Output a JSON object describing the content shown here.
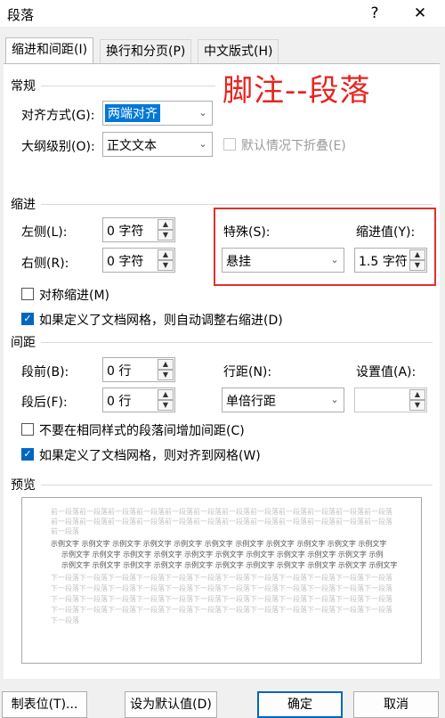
{
  "dialog": {
    "title": "段落",
    "help_label": "?",
    "close_label": "✕"
  },
  "tabs": [
    {
      "label": "缩进和间距(I)",
      "active": true
    },
    {
      "label": "换行和分页(P)",
      "active": false
    },
    {
      "label": "中文版式(H)",
      "active": false
    }
  ],
  "annotation": "脚注--段落",
  "general": {
    "section_label": "常规",
    "alignment_label": "对齐方式(G):",
    "alignment_value": "两端对齐",
    "outline_label": "大纲级别(O):",
    "outline_value": "正文文本",
    "collapse_label": "默认情况下折叠(E)"
  },
  "indent": {
    "section_label": "缩进",
    "left_label": "左侧(L):",
    "left_value": "0 字符",
    "right_label": "右侧(R):",
    "right_value": "0 字符",
    "special_label": "特殊(S):",
    "special_value": "悬挂",
    "by_label": "缩进值(Y):",
    "by_value": "1.5 字符",
    "mirror_label": "对称缩进(M)",
    "mirror_checked": false,
    "auto_adjust_label": "如果定义了文档网格，则自动调整右缩进(D)",
    "auto_adjust_checked": true
  },
  "spacing": {
    "section_label": "间距",
    "before_label": "段前(B):",
    "before_value": "0 行",
    "after_label": "段后(F):",
    "after_value": "0 行",
    "line_spacing_label": "行距(N):",
    "line_spacing_value": "单倍行距",
    "at_label": "设置值(A):",
    "at_value": "",
    "no_space_label": "不要在相同样式的段落间增加间距(C)",
    "no_space_checked": false,
    "snap_grid_label": "如果定义了文档网格，则对齐到网格(W)",
    "snap_grid_checked": true
  },
  "preview": {
    "section_label": "预览",
    "prev_lines": [
      "前一段落前一段落前一段落前一段落前一段落前一段落前一段落前一段落前一段落前一段落前一段落前一段落",
      "前一段落前一段落前一段落前一段落前一段落前一段落前一段落前一段落前一段落前一段落前一段落前一段落",
      "前一段落"
    ],
    "sample_lines": [
      "示例文字 示例文字 示例文字 示例文字 示例文字 示例文字 示例文字 示例文字 示例文字 示例文字 示例文字",
      "示例文字 示例文字 示例文字 示例文字 示例文字 示例文字 示例文字 示例文字 示例文字 示例文字 示例",
      "示例文字 示例文字 示例文字 示例文字 示例文字 示例文字 示例文字 示例文字 示例文字 示例文字 示例文字"
    ],
    "next_lines": [
      "下一段落下一段落下一段落下一段落下一段落下一段落下一段落下一段落下一段落下一段落下一段落下一段落",
      "下一段落下一段落下一段落下一段落下一段落下一段落下一段落下一段落下一段落下一段落下一段落下一段落",
      "下一段落下一段落下一段落下一段落下一段落下一段落下一段落下一段落下一段落下一段落下一段落下一段落",
      "下一段落下一段落下一段落下一段落下一段落下一段落下一段落下一段落下一段落下一段落下一段落下一段落",
      "下一段落"
    ]
  },
  "buttons": {
    "tabs_label": "制表位(T)...",
    "default_label": "设为默认值(D)",
    "ok_label": "确定",
    "cancel_label": "取消"
  },
  "colors": {
    "accent": "#0067c0",
    "annotation": "#e8231f"
  }
}
